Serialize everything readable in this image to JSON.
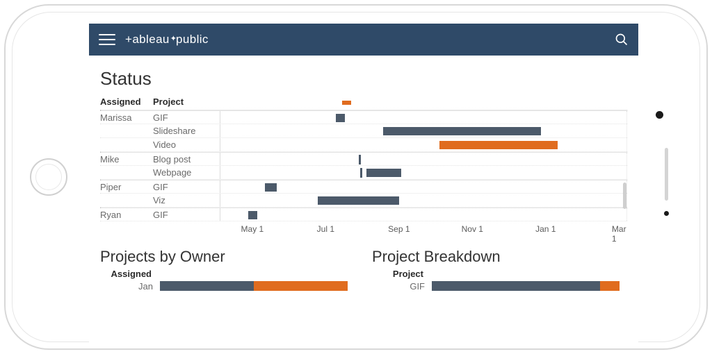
{
  "app": {
    "brand_prefix": "+ableau",
    "brand_suffix": "public"
  },
  "sections": {
    "status": "Status",
    "projects_by_owner": "Projects by Owner",
    "project_breakdown": "Project Breakdown"
  },
  "headers": {
    "assigned": "Assigned",
    "project": "Project"
  },
  "colors": {
    "gray": "#4c5a6a",
    "orange": "#e06c1f",
    "topbar": "#2f4a68"
  },
  "status": {
    "rows": [
      {
        "assigned": "Marissa",
        "project": "GIF"
      },
      {
        "assigned": "",
        "project": "Slideshare"
      },
      {
        "assigned": "",
        "project": "Video"
      },
      {
        "assigned": "Mike",
        "project": "Blog post"
      },
      {
        "assigned": "",
        "project": "Webpage"
      },
      {
        "assigned": "Piper",
        "project": "GIF"
      },
      {
        "assigned": "",
        "project": "Viz"
      },
      {
        "assigned": "Ryan",
        "project": "GIF"
      }
    ]
  },
  "axis": {
    "ticks": [
      "May 1",
      "Jul 1",
      "Sep 1",
      "Nov 1",
      "Jan 1",
      "Mar 1"
    ]
  },
  "projects_by_owner": {
    "header": "Assigned",
    "rows": [
      "Jan"
    ]
  },
  "project_breakdown": {
    "header": "Project",
    "rows": [
      "GIF"
    ]
  },
  "chart_data": [
    {
      "type": "bar",
      "title": "Status",
      "xlabel": "",
      "ylabel": "",
      "x_axis_ticks": [
        "May 1",
        "Jul 1",
        "Sep 1",
        "Nov 1",
        "Jan 1",
        "Mar 1"
      ],
      "series": [
        {
          "assigned": "Marissa",
          "project": "GIF",
          "start": "Jul 12",
          "end": "Jul 20",
          "color": "gray"
        },
        {
          "assigned": "Marissa",
          "project": "Slideshare",
          "start": "Aug 20",
          "end": "Dec 28",
          "color": "gray"
        },
        {
          "assigned": "Marissa",
          "project": "Video",
          "start": "Oct 10",
          "end": "Jan 15",
          "color": "orange"
        },
        {
          "assigned": "Mike",
          "project": "Blog post",
          "start": "Aug 1",
          "end": "Aug 3",
          "color": "gray"
        },
        {
          "assigned": "Mike",
          "project": "Webpage",
          "start": "Aug 5",
          "end": "Sep 5",
          "color": "gray"
        },
        {
          "assigned": "Mike",
          "project": "Webpage",
          "start": "Aug 1",
          "end": "Aug 3",
          "color": "gray",
          "marker": true
        },
        {
          "assigned": "Piper",
          "project": "GIF",
          "start": "May 10",
          "end": "May 20",
          "color": "gray"
        },
        {
          "assigned": "Piper",
          "project": "Viz",
          "start": "Jun 25",
          "end": "Sep 1",
          "color": "gray"
        },
        {
          "assigned": "Ryan",
          "project": "GIF",
          "start": "Apr 25",
          "end": "May 3",
          "color": "gray"
        },
        {
          "assigned": "(header mark)",
          "project": "",
          "start": "Jul 20",
          "end": "Jul 28",
          "color": "orange"
        }
      ]
    },
    {
      "type": "bar",
      "title": "Projects by Owner",
      "categories": [
        "Jan"
      ],
      "series": [
        {
          "name": "gray",
          "values": [
            48
          ]
        },
        {
          "name": "orange",
          "values": [
            48
          ]
        }
      ],
      "note": "stacked, percent of width; only first row visible"
    },
    {
      "type": "bar",
      "title": "Project Breakdown",
      "categories": [
        "GIF"
      ],
      "series": [
        {
          "name": "gray",
          "values": [
            86
          ]
        },
        {
          "name": "orange",
          "values": [
            10
          ]
        }
      ],
      "note": "stacked, percent of width; only first row visible"
    }
  ]
}
